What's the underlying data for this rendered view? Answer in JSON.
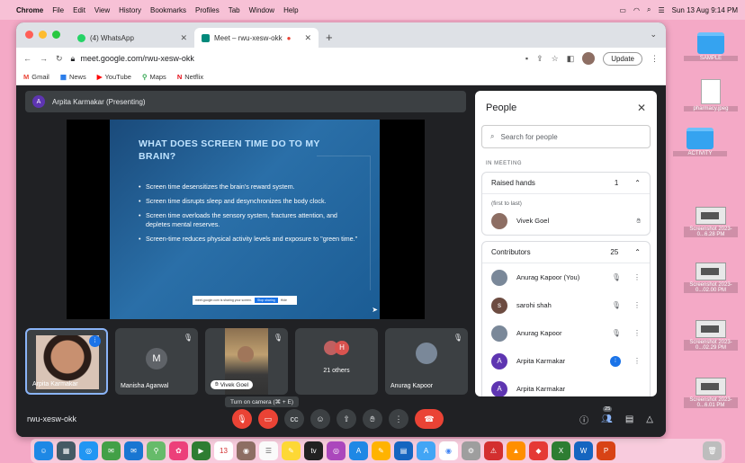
{
  "menubar": {
    "app": "Chrome",
    "items": [
      "File",
      "Edit",
      "View",
      "History",
      "Bookmarks",
      "Profiles",
      "Tab",
      "Window",
      "Help"
    ],
    "datetime": "Sun 13 Aug  9:14 PM"
  },
  "desktop": {
    "icons": [
      {
        "label": "SAMPLE",
        "type": "folder"
      },
      {
        "label": "pharmacy.jpeg",
        "type": "doc"
      },
      {
        "label": "ACTIVITY",
        "type": "folder"
      },
      {
        "label": "Screenshot 2023-0...6.28 PM",
        "type": "thumb"
      },
      {
        "label": "Screenshot 2023-0...02.00 PM",
        "type": "thumb"
      },
      {
        "label": "Screenshot 2023-0...02.29 PM",
        "type": "thumb"
      },
      {
        "label": "Screenshot 2023-0...6.01 PM",
        "type": "thumb"
      }
    ]
  },
  "browser": {
    "tabs": [
      {
        "title": "(4) WhatsApp",
        "color": "#25d366"
      },
      {
        "title": "Meet – rwu-xesw-okk",
        "color": "#00897b"
      }
    ],
    "url": "meet.google.com/rwu-xesw-okk",
    "update_label": "Update",
    "bookmarks": [
      {
        "label": "Gmail",
        "glyph": "M",
        "color": "#ea4335"
      },
      {
        "label": "News",
        "glyph": "▦",
        "color": "#1a73e8"
      },
      {
        "label": "YouTube",
        "glyph": "▶",
        "color": "#ff0000"
      },
      {
        "label": "Maps",
        "glyph": "⚲",
        "color": "#34a853"
      },
      {
        "label": "Netflix",
        "glyph": "N",
        "color": "#e50914"
      }
    ]
  },
  "meet": {
    "presenter_initial": "A",
    "presenter_label": "Arpita Karmakar (Presenting)",
    "slide": {
      "title": "WHAT DOES SCREEN TIME DO TO MY BRAIN?",
      "bullets": [
        "Screen time desensitizes the brain's reward system.",
        "Screen time disrupts sleep and desynchronizes the body clock.",
        "Screen time overloads the sensory system, fractures attention, and depletes mental reserves.",
        "Screen-time reduces physical activity levels and exposure to \"green time.\""
      ],
      "share_text": "meet.google.com is sharing your screen.",
      "stop_label": "Stop sharing",
      "hide_label": "Hide"
    },
    "tiles": [
      {
        "name": "Arpita Karmakar"
      },
      {
        "name": "Manisha Agarwal",
        "initial": "M"
      },
      {
        "name": "Vivek Goel"
      },
      {
        "name": "21 others",
        "initial": "H"
      },
      {
        "name": "Anurag Kapoor"
      }
    ],
    "tooltip": "Turn on camera (⌘ + E)",
    "meeting_code": "rwu-xesw-okk",
    "people_count": "25"
  },
  "people_panel": {
    "title": "People",
    "search_placeholder": "Search for people",
    "section_label": "IN MEETING",
    "raised_hands": {
      "label": "Raised hands",
      "count": "1",
      "note": "(first to last)",
      "people": [
        {
          "name": "Vivek Goel"
        }
      ]
    },
    "contributors": {
      "label": "Contributors",
      "count": "25",
      "people": [
        {
          "name": "Anurag Kapoor (You)",
          "initial": ""
        },
        {
          "name": "sarohi shah",
          "initial": "s"
        },
        {
          "name": "Anurag Kapoor",
          "initial": ""
        },
        {
          "name": "Arpita Karmakar",
          "initial": "A"
        },
        {
          "name": "Arpita Karmakar",
          "initial": "A"
        }
      ]
    }
  },
  "colors": {
    "accent": "#1a73e8",
    "danger": "#ea4335",
    "meet_bg": "#202124"
  }
}
